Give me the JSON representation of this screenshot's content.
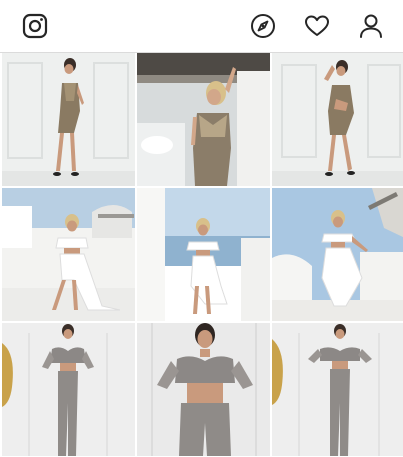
{
  "app": {
    "header": {
      "logo_icon": "instagram-icon",
      "icons": [
        "compass-icon",
        "heart-icon",
        "profile-icon"
      ],
      "colors": {
        "icon": "#262626",
        "border": "#dbdbdb",
        "background": "#ffffff"
      }
    },
    "grid": {
      "columns": 3,
      "rows": 3,
      "posts": [
        {
          "scene": "studio",
          "outfit": "metallic-dress"
        },
        {
          "scene": "bedroom",
          "outfit": "metallic-dress"
        },
        {
          "scene": "studio",
          "outfit": "metallic-dress"
        },
        {
          "scene": "santorini",
          "outfit": "white-ruffle"
        },
        {
          "scene": "santorini",
          "outfit": "white-ruffle"
        },
        {
          "scene": "santorini",
          "outfit": "white-ruffle"
        },
        {
          "scene": "studio-mirror",
          "outfit": "snakeskin-set"
        },
        {
          "scene": "studio",
          "outfit": "snakeskin-set"
        },
        {
          "scene": "studio-mirror",
          "outfit": "snakeskin-set"
        }
      ]
    }
  }
}
